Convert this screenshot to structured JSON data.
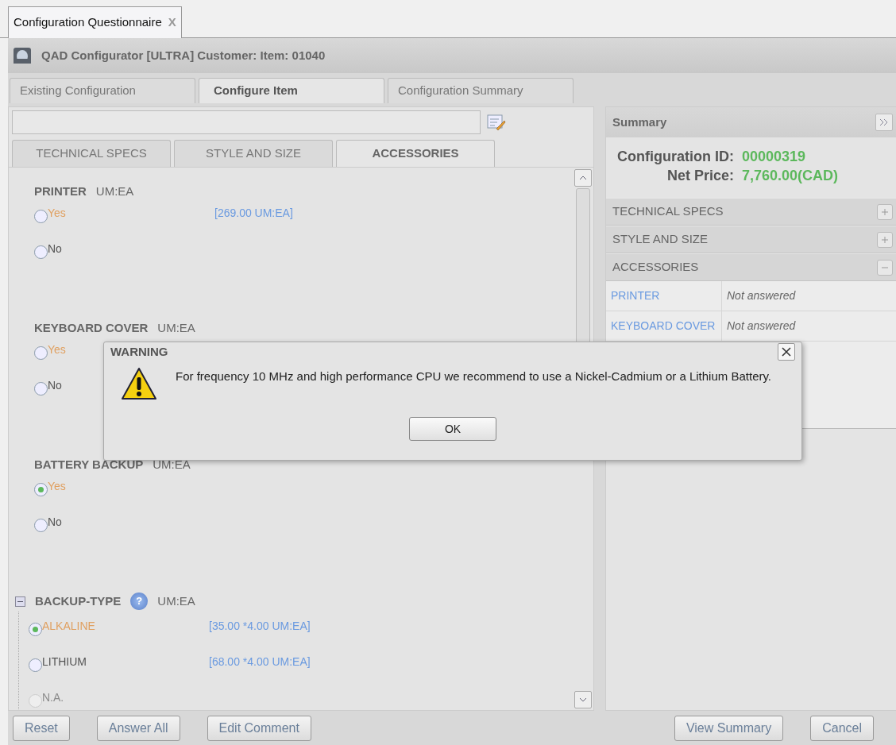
{
  "document_tab": {
    "label": "Configuration Questionnaire",
    "close": "X"
  },
  "header": {
    "title": "QAD Configurator [ULTRA] Customer: Item: 01040"
  },
  "main_tabs": [
    {
      "label": "Existing Configuration",
      "selected": false
    },
    {
      "label": "Configure Item",
      "selected": true
    },
    {
      "label": "Configuration Summary",
      "selected": false
    }
  ],
  "section_tabs": [
    {
      "label": "TECHNICAL SPECS",
      "selected": false
    },
    {
      "label": "STYLE AND SIZE",
      "selected": false
    },
    {
      "label": "ACCESSORIES",
      "selected": true
    }
  ],
  "questions": [
    {
      "label": "PRINTER",
      "unit": "UM:EA",
      "options": [
        {
          "label": "Yes",
          "price": "[269.00 UM:EA]",
          "highlighted": true,
          "selected": false,
          "disabled": false
        },
        {
          "label": "No",
          "highlighted": false,
          "selected": false,
          "disabled": false
        }
      ]
    },
    {
      "label": "KEYBOARD COVER",
      "unit": "UM:EA",
      "options": [
        {
          "label": "Yes",
          "highlighted": true,
          "selected": false,
          "disabled": false
        },
        {
          "label": "No",
          "highlighted": false,
          "selected": false,
          "disabled": false
        }
      ]
    },
    {
      "label": "BATTERY BACKUP",
      "unit": "UM:EA",
      "options": [
        {
          "label": "Yes",
          "highlighted": true,
          "selected": true,
          "disabled": false
        },
        {
          "label": "No",
          "highlighted": false,
          "selected": false,
          "disabled": false
        }
      ]
    },
    {
      "label": "BACKUP-TYPE",
      "unit": "UM:EA",
      "expanded": true,
      "help": "?",
      "options": [
        {
          "label": "ALKALINE",
          "price": "[35.00 *4.00 UM:EA]",
          "highlighted": true,
          "selected": true,
          "disabled": false
        },
        {
          "label": "LITHIUM",
          "price": "[68.00 *4.00 UM:EA]",
          "highlighted": false,
          "selected": false,
          "disabled": false
        },
        {
          "label": "N.A.",
          "highlighted": false,
          "selected": false,
          "disabled": true
        }
      ]
    }
  ],
  "summary": {
    "title": "Summary",
    "config_id_label": "Configuration ID:",
    "config_id": "00000319",
    "net_price_label": "Net Price:",
    "net_price": "7,760.00(CAD)",
    "groups": [
      {
        "label": "TECHNICAL SPECS",
        "expanded": false
      },
      {
        "label": "STYLE AND SIZE",
        "expanded": false
      },
      {
        "label": "ACCESSORIES",
        "expanded": true,
        "rows": [
          {
            "name": "PRINTER",
            "value": "Not answered"
          },
          {
            "name": "KEYBOARD COVER",
            "value": "Not answered"
          }
        ]
      }
    ]
  },
  "dialog": {
    "title": "WARNING",
    "message": "For frequency 10 MHz and high performance CPU we recommend to use a Nickel-Cadmium or a Lithium Battery.",
    "button": "OK"
  },
  "footer_left": [
    "Reset",
    "Answer All",
    "Edit Comment"
  ],
  "footer_right": [
    "View Summary",
    "Cancel"
  ]
}
